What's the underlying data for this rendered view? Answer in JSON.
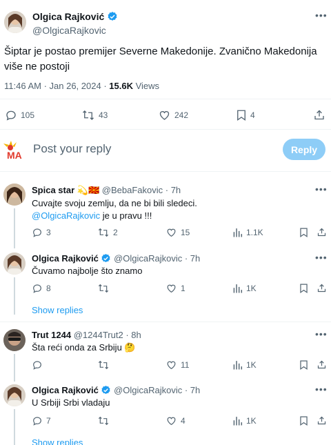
{
  "main_tweet": {
    "author_name": "Olgica Rajković",
    "handle": "@OlgicaRajkovic",
    "text": "Šiptar je postao premijer Severne Makedonije. Zvanično Makedonija više ne postoji",
    "timestamp": "11:46 AM · Jan 26, 2024",
    "separator": " · ",
    "views_count": "15.6K",
    "views_label": " Views",
    "replies": "105",
    "retweets": "43",
    "likes": "242",
    "bookmarks": "4"
  },
  "composer": {
    "placeholder": "Post your reply",
    "button_label": "Reply",
    "avatar_text": "MA"
  },
  "replies": [
    {
      "author_name": "Spica star",
      "emoji": "💫🇲🇰",
      "handle": "@BebaFakovic",
      "time": " · 7h",
      "text_line1": "Cuvajte svoju zemlju, da ne bi bili sledeci.",
      "mention": "@OlgicaRajkovic",
      "text_line2_rest": " je u pravu !!!",
      "replies": "3",
      "retweets": "2",
      "likes": "15",
      "views": "1.1K"
    },
    {
      "author_name": "Olgica Rajković",
      "handle": "@OlgicaRajkovic",
      "time": " · 7h",
      "text": "Čuvamo najbolje što znamo",
      "replies": "8",
      "retweets": "",
      "likes": "1",
      "views": "1K",
      "show_replies": "Show replies"
    },
    {
      "author_name": "Trut 1244",
      "handle": "@1244Trut2",
      "time": " · 8h",
      "text": "Šta reći onda za Srbiju 🤔",
      "replies": "",
      "retweets": "",
      "likes": "11",
      "views": "1K"
    },
    {
      "author_name": "Olgica Rajković",
      "handle": "@OlgicaRajkovic",
      "time": " · 7h",
      "text": "U Srbiji Srbi vladaju",
      "replies": "7",
      "retweets": "",
      "likes": "4",
      "views": "1K",
      "show_replies": "Show replies"
    }
  ],
  "colors": {
    "accent": "#1d9bf0",
    "muted": "#536471",
    "reply_button_disabled": "#8ecdf7"
  }
}
